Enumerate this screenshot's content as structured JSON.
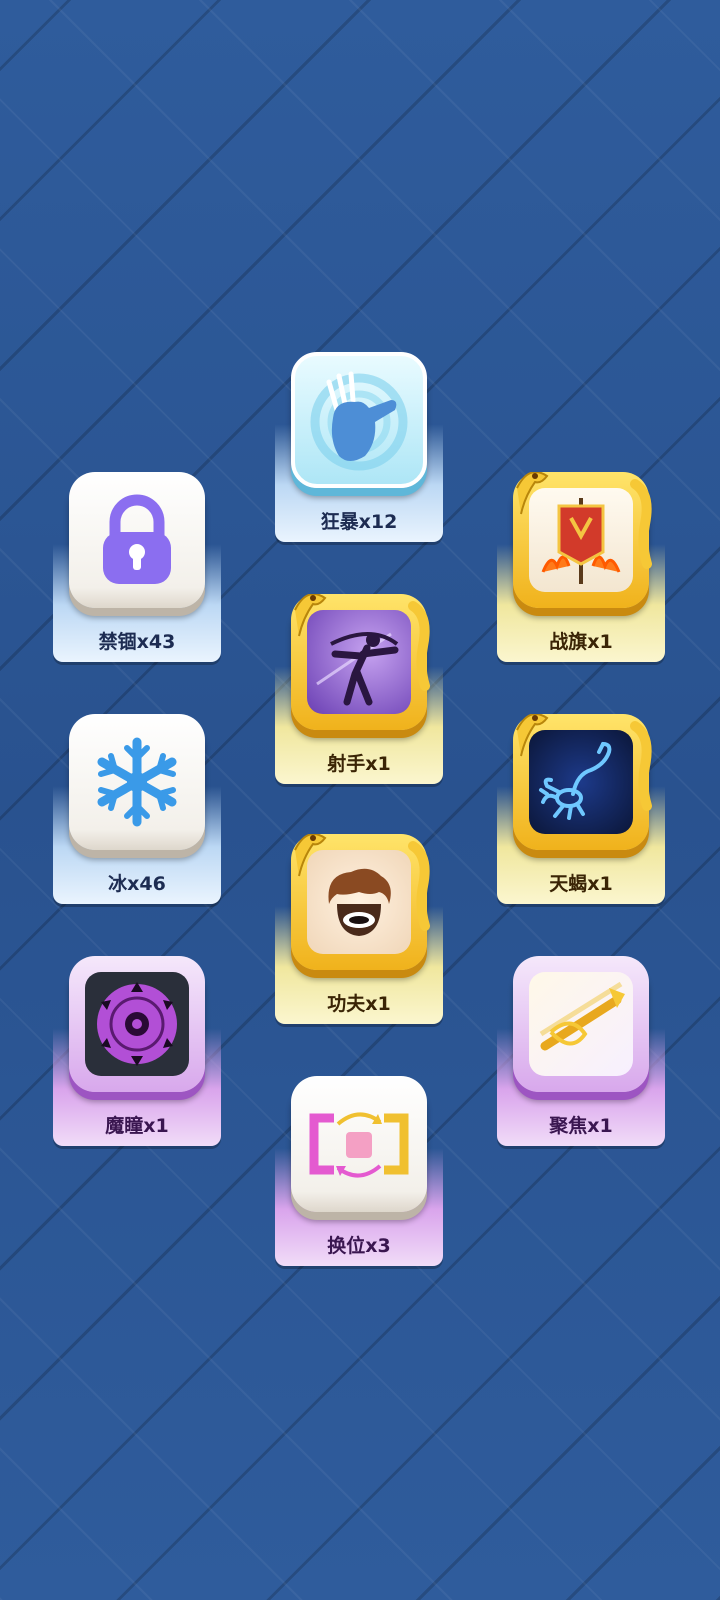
{
  "skills": [
    {
      "id": "kuangbao",
      "label": "狂暴x12",
      "icon": "rage-icon"
    },
    {
      "id": "jingu",
      "label": "禁锢x43",
      "icon": "lock-icon"
    },
    {
      "id": "zhanqi",
      "label": "战旗x1",
      "icon": "war-banner-icon"
    },
    {
      "id": "sheshou",
      "label": "射手x1",
      "icon": "archer-icon"
    },
    {
      "id": "bing",
      "label": "冰x46",
      "icon": "snowflake-icon"
    },
    {
      "id": "tianxie",
      "label": "天蝎x1",
      "icon": "scorpion-icon"
    },
    {
      "id": "gongfu",
      "label": "功夫x1",
      "icon": "kungfu-icon"
    },
    {
      "id": "motong",
      "label": "魔瞳x1",
      "icon": "magic-eye-icon"
    },
    {
      "id": "jujiao",
      "label": "聚焦x1",
      "icon": "focus-bow-icon"
    },
    {
      "id": "huanwei",
      "label": "换位x3",
      "icon": "swap-icon"
    }
  ],
  "colors": {
    "background": "#2d5a9a",
    "blue_card": "#bcd8f4",
    "gold_card": "#f0e79e",
    "purple_card": "#d9a4ec"
  }
}
